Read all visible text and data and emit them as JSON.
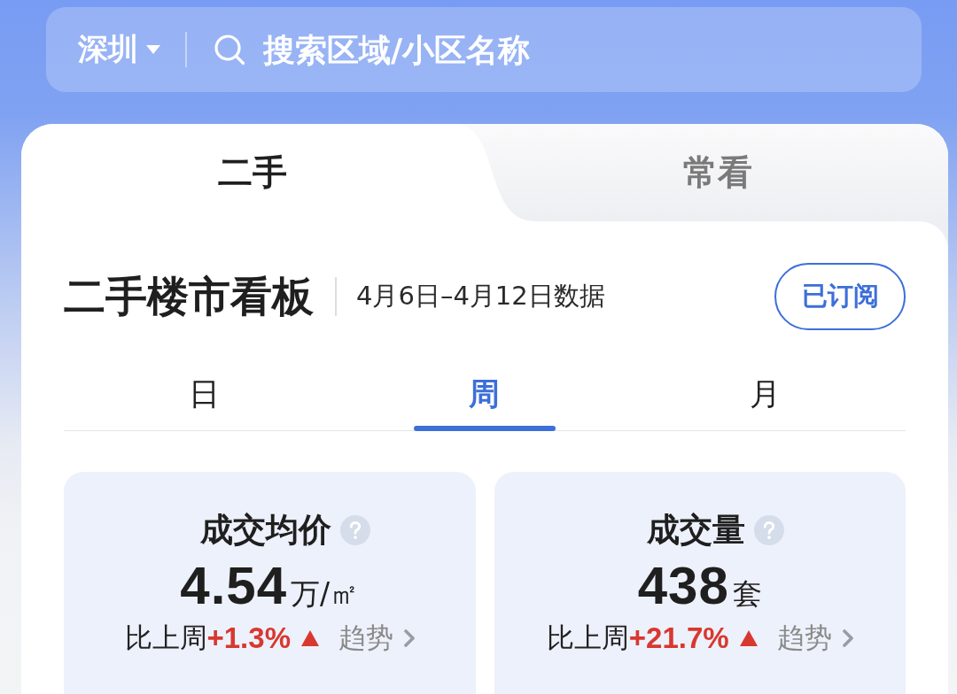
{
  "search_bar": {
    "city": "深圳",
    "placeholder": "搜索区域/小区名称"
  },
  "tabs": [
    {
      "label": "二手",
      "selected": true
    },
    {
      "label": "常看",
      "selected": false
    }
  ],
  "board": {
    "title": "二手楼市看板",
    "date_range": "4月6日–4月12日数据",
    "subscribe_button": "已订阅"
  },
  "periods": [
    {
      "label": "日",
      "selected": false
    },
    {
      "label": "周",
      "selected": true
    },
    {
      "label": "月",
      "selected": false
    }
  ],
  "stats": [
    {
      "title": "成交均价",
      "value": "4.54",
      "unit": "万/㎡",
      "compare_label": "比上周",
      "change": "+1.3%",
      "rising": true,
      "trend_link": "趋势"
    },
    {
      "title": "成交量",
      "value": "438",
      "unit": "套",
      "compare_label": "比上周",
      "change": "+21.7%",
      "rising": true,
      "trend_link": "趋势"
    }
  ]
}
